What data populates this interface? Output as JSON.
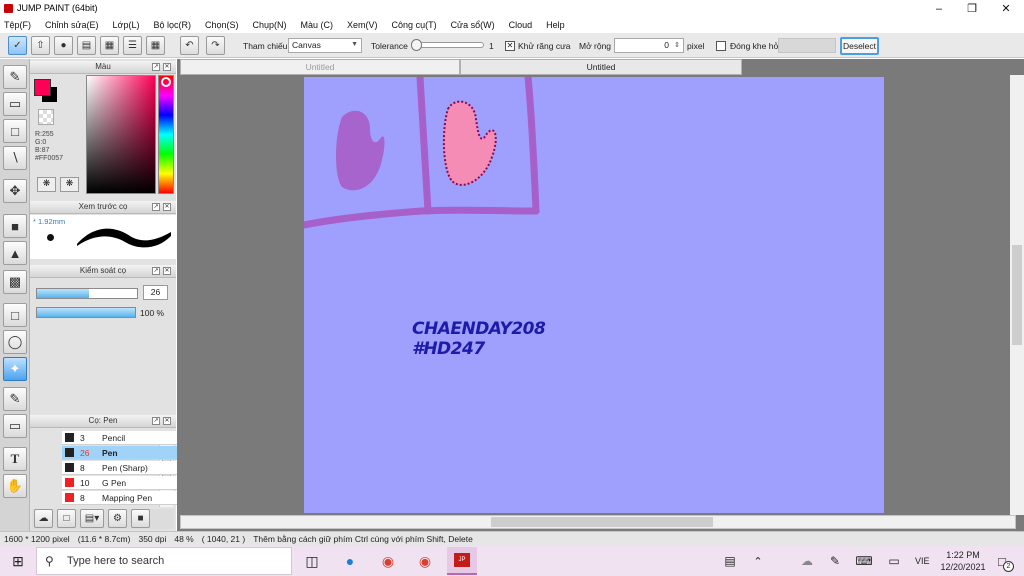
{
  "window": {
    "title": "JUMP PAINT (64bit)"
  },
  "menu": [
    "Tệp(F)",
    "Chỉnh sửa(E)",
    "Lớp(L)",
    "Bộ lọc(R)",
    "Chọn(S)",
    "Chụp(N)",
    "Màu (C)",
    "Xem(V)",
    "Công cụ(T)",
    "Cửa sổ(W)",
    "Cloud",
    "Help"
  ],
  "toolbar": {
    "reference_label": "Tham chiếu",
    "reference_value": "Canvas",
    "tolerance_label": "Tolerance",
    "tolerance_value": "1",
    "antialias_label": "Khử răng cưa",
    "expand_label": "Mở rộng",
    "expand_value": "0",
    "expand_unit": "pixel",
    "close_gap_label": "Đóng khe hở",
    "deselect_label": "Deselect"
  },
  "color_panel": {
    "title": "Màu",
    "r": "R:255",
    "g": "G:0",
    "b": "B:87",
    "hex": "#FF0057",
    "fg_color": "#ff0057"
  },
  "preview_panel": {
    "title": "Xem trước cọ",
    "size": "1.92mm"
  },
  "control_panel": {
    "title": "Kiểm soát cọ",
    "size_value": "26",
    "size_fraction": 0.52,
    "opacity_value": "100 %",
    "opacity_fraction": 1.0
  },
  "brush_panel": {
    "title": "Cọ: Pen",
    "items": [
      {
        "size": "3",
        "name": "Pencil",
        "color": "#222222"
      },
      {
        "size": "26",
        "name": "Pen",
        "color": "#222222"
      },
      {
        "size": "8",
        "name": "Pen (Sharp)",
        "color": "#222222"
      },
      {
        "size": "10",
        "name": "G Pen",
        "color": "#ee2222"
      },
      {
        "size": "8",
        "name": "Mapping Pen",
        "color": "#ee2222"
      }
    ]
  },
  "tabs": [
    "Untitled",
    "Untitled"
  ],
  "canvas": {
    "line1": "CHAENDAY208",
    "line2": "#HD247",
    "bg_color": "#9f9ffd"
  },
  "status": {
    "size": "1600 * 1200 pixel",
    "dims": "(11.6 * 8.7cm)",
    "dpi": "350 dpi",
    "zoom": "48 %",
    "coords": "( 1040, 21 )",
    "hint": "Thêm bằng cách giữ phím Ctrl cùng với phím Shift, Delete"
  },
  "taskbar": {
    "search_placeholder": "Type here to search",
    "lang": "VIE",
    "time": "1:22 PM",
    "date": "12/20/2021",
    "notif_count": "2"
  }
}
